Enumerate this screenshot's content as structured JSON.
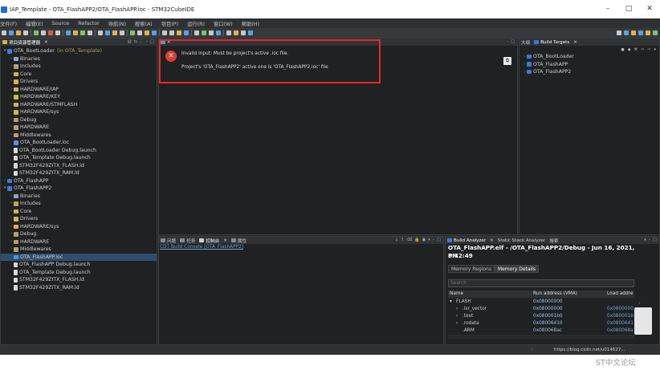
{
  "window": {
    "title": "IAP_Template - OTA_FlashAPP2/OTA_FlashAPP.ioc - STM32CubeIDE",
    "minimize": "–",
    "maximize": "□",
    "close": "✕"
  },
  "menu": [
    "文件(F)",
    "编辑(E)",
    "Source",
    "Refactor",
    "导航(N)",
    "搜索(A)",
    "项目(P)",
    "运行(R)",
    "窗口(W)",
    "帮助(H)"
  ],
  "project_explorer": {
    "tab": "项目资源管理器",
    "items": [
      {
        "label": "OTA_BootLoader",
        "tag": "(in OTA_Template)",
        "depth": 0,
        "arrow": "▾",
        "icon": "proj"
      },
      {
        "label": "Binaries",
        "depth": 1,
        "arrow": "›",
        "icon": "bin"
      },
      {
        "label": "Includes",
        "depth": 1,
        "arrow": "›",
        "icon": "inc"
      },
      {
        "label": "Core",
        "depth": 1,
        "arrow": "›",
        "icon": "folder"
      },
      {
        "label": "Drivers",
        "depth": 1,
        "arrow": "›",
        "icon": "folder"
      },
      {
        "label": "HARDWARE/IAP",
        "depth": 1,
        "arrow": "›",
        "icon": "folder"
      },
      {
        "label": "HARDWARE/KEY",
        "depth": 1,
        "arrow": "›",
        "icon": "folder"
      },
      {
        "label": "HARDWARE/STMFLASH",
        "depth": 1,
        "arrow": "›",
        "icon": "folder"
      },
      {
        "label": "HARDWARE/sys",
        "depth": 1,
        "arrow": "›",
        "icon": "folder"
      },
      {
        "label": "Debug",
        "depth": 1,
        "arrow": "›",
        "icon": "binfolder"
      },
      {
        "label": "HARDWARE",
        "depth": 1,
        "arrow": "›",
        "icon": "binfolder"
      },
      {
        "label": "Middlewares",
        "depth": 1,
        "arrow": "›",
        "icon": "binfolder"
      },
      {
        "label": "OTA_BootLoader.ioc",
        "depth": 1,
        "arrow": "",
        "icon": "ioc"
      },
      {
        "label": "OTA_BootLoader Debug.launch",
        "depth": 1,
        "arrow": "",
        "icon": "file"
      },
      {
        "label": "OTA_Template Debug.launch",
        "depth": 1,
        "arrow": "",
        "icon": "file"
      },
      {
        "label": "STM32F429ZITX_FLASH.ld",
        "depth": 1,
        "arrow": "",
        "icon": "file"
      },
      {
        "label": "STM32F429ZITX_RAM.ld",
        "depth": 1,
        "arrow": "",
        "icon": "file"
      },
      {
        "label": "OTA_FlashAPP",
        "depth": 0,
        "arrow": "›",
        "icon": "proj"
      },
      {
        "label": "OTA_FlashAPP2",
        "depth": 0,
        "arrow": "▾",
        "icon": "proj"
      },
      {
        "label": "Binaries",
        "depth": 1,
        "arrow": "›",
        "icon": "bin"
      },
      {
        "label": "Includes",
        "depth": 1,
        "arrow": "›",
        "icon": "inc"
      },
      {
        "label": "Core",
        "depth": 1,
        "arrow": "›",
        "icon": "folder"
      },
      {
        "label": "Drivers",
        "depth": 1,
        "arrow": "›",
        "icon": "folder"
      },
      {
        "label": "HARDWARE/sys",
        "depth": 1,
        "arrow": "›",
        "icon": "folder"
      },
      {
        "label": "Debug",
        "depth": 1,
        "arrow": "›",
        "icon": "binfolder"
      },
      {
        "label": "HARDWARE",
        "depth": 1,
        "arrow": "›",
        "icon": "binfolder"
      },
      {
        "label": "Middlewares",
        "depth": 1,
        "arrow": "›",
        "icon": "binfolder"
      },
      {
        "label": "OTA_FlashAPP.ioc",
        "depth": 1,
        "arrow": "",
        "icon": "ioc",
        "selected": true
      },
      {
        "label": "OTA_FlashAPP Debug.launch",
        "depth": 1,
        "arrow": "",
        "icon": "file"
      },
      {
        "label": "OTA_Template Debug.launch",
        "depth": 1,
        "arrow": "",
        "icon": "file"
      },
      {
        "label": "STM32F429ZITX_FLASH.ld",
        "depth": 1,
        "arrow": "",
        "icon": "file"
      },
      {
        "label": "STM32F429ZITX_RAM.ld",
        "depth": 1,
        "arrow": "",
        "icon": "file"
      }
    ]
  },
  "error": {
    "line1": "Invalid input: Must be project's active .ioc file.",
    "line2": "Project's 'OTA_FlashAPP2' active one is 'OTA_FlashAPP2.ioc' file"
  },
  "build_targets": {
    "tabs": [
      "大纲",
      "Build Targets"
    ],
    "items": [
      "OTA_BootLoader",
      "OTA_FlashAPP",
      "OTA_FlashAPP2"
    ]
  },
  "console": {
    "tabs": [
      "问题",
      "任务",
      "控制台",
      "属性"
    ],
    "active_tab_index": 2,
    "link": "CDT Build Console [OTA_FlashAPP2]"
  },
  "build_analyzer": {
    "tabs": [
      "Build Analyzer",
      "Static Stack Analyzer",
      "搜索"
    ],
    "title_line1": "OTA_FlashAPP.elf - /OTA_FlashAPP2/Debug - Jun 16, 2021, 8:12:49",
    "title_line2": "PM",
    "subtabs": [
      "Memory Regions",
      "Memory Details"
    ],
    "search_placeholder": "Search",
    "columns": [
      "Name",
      "Run address (VMA)",
      "Load addre"
    ],
    "rows": [
      {
        "name": "FLASH",
        "arrow": "▾",
        "run": "0x08000000",
        "load": ""
      },
      {
        "name": ".isr_vector",
        "arrow": "›",
        "run": "0x08000000",
        "load": "0x0800000"
      },
      {
        "name": ".text",
        "arrow": "›",
        "run": "0x080001b0",
        "load": "0x080001b"
      },
      {
        "name": ".rodata",
        "arrow": "›",
        "run": "0x08006410",
        "load": "0x0800641"
      },
      {
        "name": ".ARM",
        "arrow": "",
        "run": "0x080068ac",
        "load": "0x080068a"
      }
    ]
  },
  "status": {
    "url": "https://blog.csdn.net/u014627..."
  },
  "watermark": "ST中文论坛",
  "colors": {
    "error_highlight": "#e8282a",
    "panel_bg": "#1f2122",
    "link": "#6fa0d8"
  }
}
